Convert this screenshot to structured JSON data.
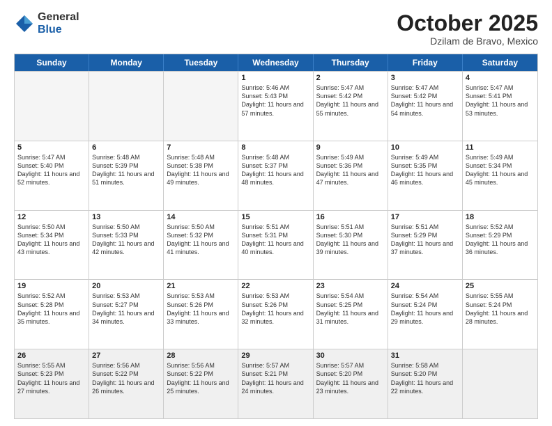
{
  "logo": {
    "general": "General",
    "blue": "Blue"
  },
  "header": {
    "month": "October 2025",
    "location": "Dzilam de Bravo, Mexico"
  },
  "weekdays": [
    "Sunday",
    "Monday",
    "Tuesday",
    "Wednesday",
    "Thursday",
    "Friday",
    "Saturday"
  ],
  "weeks": [
    [
      {
        "day": "",
        "sunrise": "",
        "sunset": "",
        "daylight": ""
      },
      {
        "day": "",
        "sunrise": "",
        "sunset": "",
        "daylight": ""
      },
      {
        "day": "",
        "sunrise": "",
        "sunset": "",
        "daylight": ""
      },
      {
        "day": "1",
        "sunrise": "Sunrise: 5:46 AM",
        "sunset": "Sunset: 5:43 PM",
        "daylight": "Daylight: 11 hours and 57 minutes."
      },
      {
        "day": "2",
        "sunrise": "Sunrise: 5:47 AM",
        "sunset": "Sunset: 5:42 PM",
        "daylight": "Daylight: 11 hours and 55 minutes."
      },
      {
        "day": "3",
        "sunrise": "Sunrise: 5:47 AM",
        "sunset": "Sunset: 5:42 PM",
        "daylight": "Daylight: 11 hours and 54 minutes."
      },
      {
        "day": "4",
        "sunrise": "Sunrise: 5:47 AM",
        "sunset": "Sunset: 5:41 PM",
        "daylight": "Daylight: 11 hours and 53 minutes."
      }
    ],
    [
      {
        "day": "5",
        "sunrise": "Sunrise: 5:47 AM",
        "sunset": "Sunset: 5:40 PM",
        "daylight": "Daylight: 11 hours and 52 minutes."
      },
      {
        "day": "6",
        "sunrise": "Sunrise: 5:48 AM",
        "sunset": "Sunset: 5:39 PM",
        "daylight": "Daylight: 11 hours and 51 minutes."
      },
      {
        "day": "7",
        "sunrise": "Sunrise: 5:48 AM",
        "sunset": "Sunset: 5:38 PM",
        "daylight": "Daylight: 11 hours and 49 minutes."
      },
      {
        "day": "8",
        "sunrise": "Sunrise: 5:48 AM",
        "sunset": "Sunset: 5:37 PM",
        "daylight": "Daylight: 11 hours and 48 minutes."
      },
      {
        "day": "9",
        "sunrise": "Sunrise: 5:49 AM",
        "sunset": "Sunset: 5:36 PM",
        "daylight": "Daylight: 11 hours and 47 minutes."
      },
      {
        "day": "10",
        "sunrise": "Sunrise: 5:49 AM",
        "sunset": "Sunset: 5:35 PM",
        "daylight": "Daylight: 11 hours and 46 minutes."
      },
      {
        "day": "11",
        "sunrise": "Sunrise: 5:49 AM",
        "sunset": "Sunset: 5:34 PM",
        "daylight": "Daylight: 11 hours and 45 minutes."
      }
    ],
    [
      {
        "day": "12",
        "sunrise": "Sunrise: 5:50 AM",
        "sunset": "Sunset: 5:34 PM",
        "daylight": "Daylight: 11 hours and 43 minutes."
      },
      {
        "day": "13",
        "sunrise": "Sunrise: 5:50 AM",
        "sunset": "Sunset: 5:33 PM",
        "daylight": "Daylight: 11 hours and 42 minutes."
      },
      {
        "day": "14",
        "sunrise": "Sunrise: 5:50 AM",
        "sunset": "Sunset: 5:32 PM",
        "daylight": "Daylight: 11 hours and 41 minutes."
      },
      {
        "day": "15",
        "sunrise": "Sunrise: 5:51 AM",
        "sunset": "Sunset: 5:31 PM",
        "daylight": "Daylight: 11 hours and 40 minutes."
      },
      {
        "day": "16",
        "sunrise": "Sunrise: 5:51 AM",
        "sunset": "Sunset: 5:30 PM",
        "daylight": "Daylight: 11 hours and 39 minutes."
      },
      {
        "day": "17",
        "sunrise": "Sunrise: 5:51 AM",
        "sunset": "Sunset: 5:29 PM",
        "daylight": "Daylight: 11 hours and 37 minutes."
      },
      {
        "day": "18",
        "sunrise": "Sunrise: 5:52 AM",
        "sunset": "Sunset: 5:29 PM",
        "daylight": "Daylight: 11 hours and 36 minutes."
      }
    ],
    [
      {
        "day": "19",
        "sunrise": "Sunrise: 5:52 AM",
        "sunset": "Sunset: 5:28 PM",
        "daylight": "Daylight: 11 hours and 35 minutes."
      },
      {
        "day": "20",
        "sunrise": "Sunrise: 5:53 AM",
        "sunset": "Sunset: 5:27 PM",
        "daylight": "Daylight: 11 hours and 34 minutes."
      },
      {
        "day": "21",
        "sunrise": "Sunrise: 5:53 AM",
        "sunset": "Sunset: 5:26 PM",
        "daylight": "Daylight: 11 hours and 33 minutes."
      },
      {
        "day": "22",
        "sunrise": "Sunrise: 5:53 AM",
        "sunset": "Sunset: 5:26 PM",
        "daylight": "Daylight: 11 hours and 32 minutes."
      },
      {
        "day": "23",
        "sunrise": "Sunrise: 5:54 AM",
        "sunset": "Sunset: 5:25 PM",
        "daylight": "Daylight: 11 hours and 31 minutes."
      },
      {
        "day": "24",
        "sunrise": "Sunrise: 5:54 AM",
        "sunset": "Sunset: 5:24 PM",
        "daylight": "Daylight: 11 hours and 29 minutes."
      },
      {
        "day": "25",
        "sunrise": "Sunrise: 5:55 AM",
        "sunset": "Sunset: 5:24 PM",
        "daylight": "Daylight: 11 hours and 28 minutes."
      }
    ],
    [
      {
        "day": "26",
        "sunrise": "Sunrise: 5:55 AM",
        "sunset": "Sunset: 5:23 PM",
        "daylight": "Daylight: 11 hours and 27 minutes."
      },
      {
        "day": "27",
        "sunrise": "Sunrise: 5:56 AM",
        "sunset": "Sunset: 5:22 PM",
        "daylight": "Daylight: 11 hours and 26 minutes."
      },
      {
        "day": "28",
        "sunrise": "Sunrise: 5:56 AM",
        "sunset": "Sunset: 5:22 PM",
        "daylight": "Daylight: 11 hours and 25 minutes."
      },
      {
        "day": "29",
        "sunrise": "Sunrise: 5:57 AM",
        "sunset": "Sunset: 5:21 PM",
        "daylight": "Daylight: 11 hours and 24 minutes."
      },
      {
        "day": "30",
        "sunrise": "Sunrise: 5:57 AM",
        "sunset": "Sunset: 5:20 PM",
        "daylight": "Daylight: 11 hours and 23 minutes."
      },
      {
        "day": "31",
        "sunrise": "Sunrise: 5:58 AM",
        "sunset": "Sunset: 5:20 PM",
        "daylight": "Daylight: 11 hours and 22 minutes."
      },
      {
        "day": "",
        "sunrise": "",
        "sunset": "",
        "daylight": ""
      }
    ]
  ]
}
